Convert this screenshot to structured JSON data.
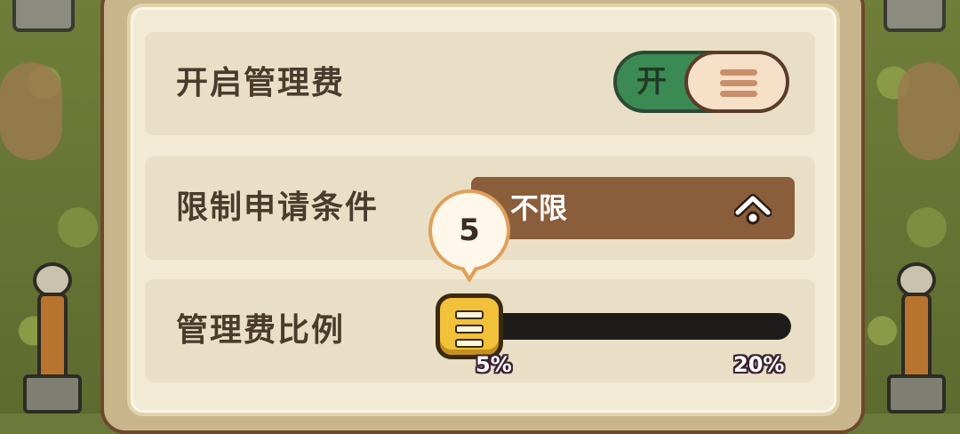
{
  "rows": [
    {
      "label": "开启管理费",
      "toggle": {
        "state_label": "开",
        "on": true
      }
    },
    {
      "label": "限制申请条件",
      "dropdown": {
        "selected": "不限",
        "icon": "chevron-up-icon"
      }
    },
    {
      "label": "管理费比例",
      "slider": {
        "value": 5,
        "value_label": "5",
        "min_label": "5%",
        "max_label": "20%",
        "min": 5,
        "max": 20
      }
    }
  ],
  "colors": {
    "panel": "#f2ead4",
    "row": "#e8dfc6",
    "toggle_on": "#3c8a53",
    "dropdown": "#8a5d3b",
    "slider_thumb": "#f2c13a",
    "text": "#4a3b2c"
  }
}
